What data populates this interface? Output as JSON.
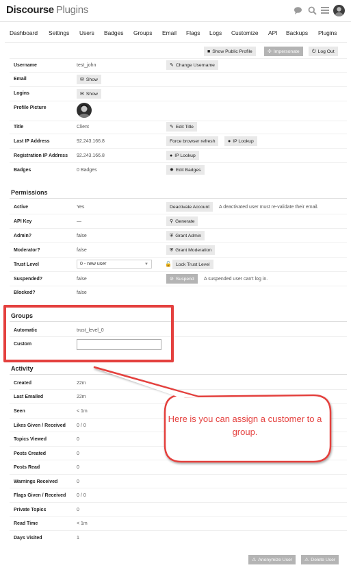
{
  "header": {
    "brand": "Discourse",
    "brand_sub": "Plugins"
  },
  "nav": [
    "Dashboard",
    "Settings",
    "Users",
    "Badges",
    "Groups",
    "Email",
    "Flags",
    "Logs",
    "Customize",
    "API",
    "Backups",
    "Plugins"
  ],
  "actions": {
    "show_profile": "Show Public Profile",
    "impersonate": "Impersonate",
    "logout": "Log Out"
  },
  "user": {
    "username_label": "Username",
    "username": "test_john",
    "change_username": "Change Username",
    "email_label": "Email",
    "email_show": "Show",
    "logins_label": "Logins",
    "logins_show": "Show",
    "picture_label": "Profile Picture",
    "title_label": "Title",
    "title": "Client",
    "edit_title": "Edit Title",
    "last_ip_label": "Last IP Address",
    "last_ip": "92.243.166.8",
    "force_refresh": "Force browser refresh",
    "ip_lookup": "IP Lookup",
    "reg_ip_label": "Registration IP Address",
    "reg_ip": "92.243.166.8",
    "ip_lookup2": "IP Lookup",
    "badges_label": "Badges",
    "badges": "0 Badges",
    "edit_badges": "Edit Badges"
  },
  "permissions": {
    "title": "Permissions",
    "active_label": "Active",
    "active": "Yes",
    "deactivate": "Deactivate Account",
    "deactivate_note": "A deactivated user must re-validate their email.",
    "apikey_label": "API Key",
    "apikey": "—",
    "generate": "Generate",
    "admin_label": "Admin?",
    "admin": "false",
    "grant_admin": "Grant Admin",
    "mod_label": "Moderator?",
    "mod": "false",
    "grant_mod": "Grant Moderation",
    "trust_label": "Trust Level",
    "trust": "0 - new user",
    "lock_trust": "Lock Trust Level",
    "suspended_label": "Suspended?",
    "suspended": "false",
    "suspend": "Suspend",
    "suspend_note": "A suspended user can't log in.",
    "blocked_label": "Blocked?",
    "blocked": "false"
  },
  "groups": {
    "title": "Groups",
    "auto_label": "Automatic",
    "auto": "trust_level_0",
    "custom_label": "Custom",
    "custom_value": ""
  },
  "activity": {
    "title": "Activity",
    "rows": [
      {
        "label": "Created",
        "value": "22m"
      },
      {
        "label": "Last Emailed",
        "value": "22m"
      },
      {
        "label": "Seen",
        "value": "< 1m"
      },
      {
        "label": "Likes Given / Received",
        "value": "0 / 0"
      },
      {
        "label": "Topics Viewed",
        "value": "0"
      },
      {
        "label": "Posts Created",
        "value": "0"
      },
      {
        "label": "Posts Read",
        "value": "0"
      },
      {
        "label": "Warnings Received",
        "value": "0"
      },
      {
        "label": "Flags Given / Received",
        "value": "0 / 0"
      },
      {
        "label": "Private Topics",
        "value": "0"
      },
      {
        "label": "Read Time",
        "value": "< 1m"
      },
      {
        "label": "Days Visited",
        "value": "1"
      }
    ]
  },
  "footer": {
    "anonymize": "Anonymize User",
    "delete": "Delete User"
  },
  "callout": {
    "text": "Here is you can assign a customer to a group.",
    "color": "#e4403e"
  },
  "colors": {
    "button_bg": "#e9e9e9",
    "button_disabled": "#b4b4b4",
    "annotation_red": "#e4403e"
  }
}
